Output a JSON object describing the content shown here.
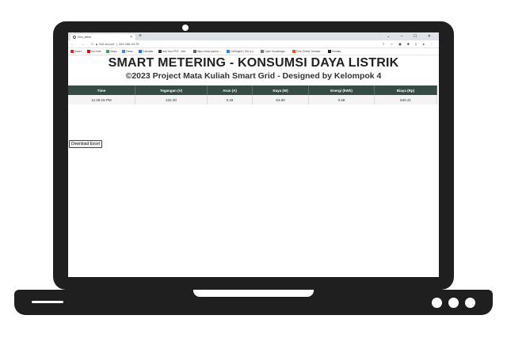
{
  "browser": {
    "tab_title": "Grs_Web",
    "tab_close": "×",
    "new_tab": "+",
    "window_controls": "⌄ – ☐ ✕",
    "nav": "← → C",
    "security": "▲ Not secure",
    "url": "192.168.43.75",
    "bookmarks": [
      "Gmail",
      "YouTube",
      "Maps",
      "News",
      "Translate",
      "Ask Your PDF - Inte...",
      "https://chat.openai....",
      "GetDigest | Get a d...",
      "Open Knowledge...",
      "Free Online Translat...",
      "Humata"
    ]
  },
  "page": {
    "title": "SMART METERING - KONSUMSI DAYA LISTRIK",
    "subtitle": "©2023 Project Mata Kuliah Smart Grid - Designed by Kelompok 4",
    "table": {
      "headers": [
        "Time",
        "Tegangan (V)",
        "Arus (A)",
        "Daya (W)",
        "Energi (kWh)",
        "Biaya (Rp)"
      ],
      "rows": [
        [
          "11:26:15 PM",
          "232.30",
          "0.28",
          "63.80",
          "0.58",
          "840.41"
        ]
      ]
    },
    "download_button": "Download Excel"
  }
}
